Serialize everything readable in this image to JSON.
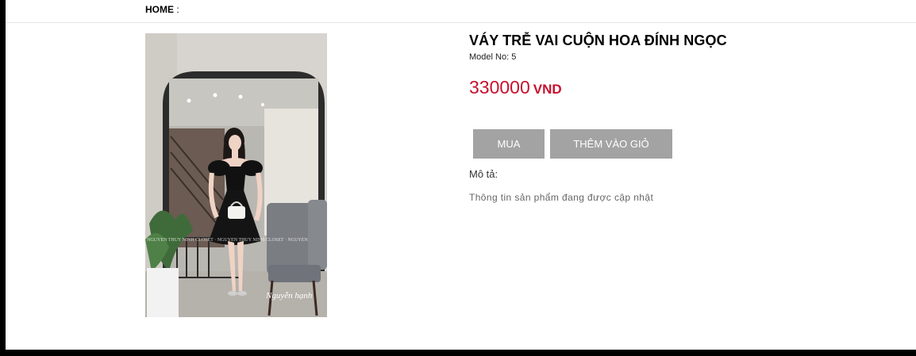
{
  "breadcrumb": {
    "home": "HOME",
    "separator": ":"
  },
  "product": {
    "title": "VÁY TRỄ VAI CUỘN HOA ĐÍNH NGỌC",
    "model": "Model No: 5",
    "price": "330000",
    "currency": "VND",
    "image_alt": "Product photo: woman in black off-shoulder dress with flower sleeves",
    "image_signature": "Nguyễn hạnh",
    "image_watermark": "NGUYEN THUY NINH CLOSET"
  },
  "actions": {
    "buy": "MUA",
    "add_to_cart": "THÊM VÀO GIỎ"
  },
  "description": {
    "label": "Mô tả:",
    "text": "Thông tin sản phẩm đang được cập nhật"
  },
  "colors": {
    "price": "#c8102e",
    "button_bg": "#a3a3a3",
    "button_text": "#ffffff",
    "frame": "#000000"
  }
}
